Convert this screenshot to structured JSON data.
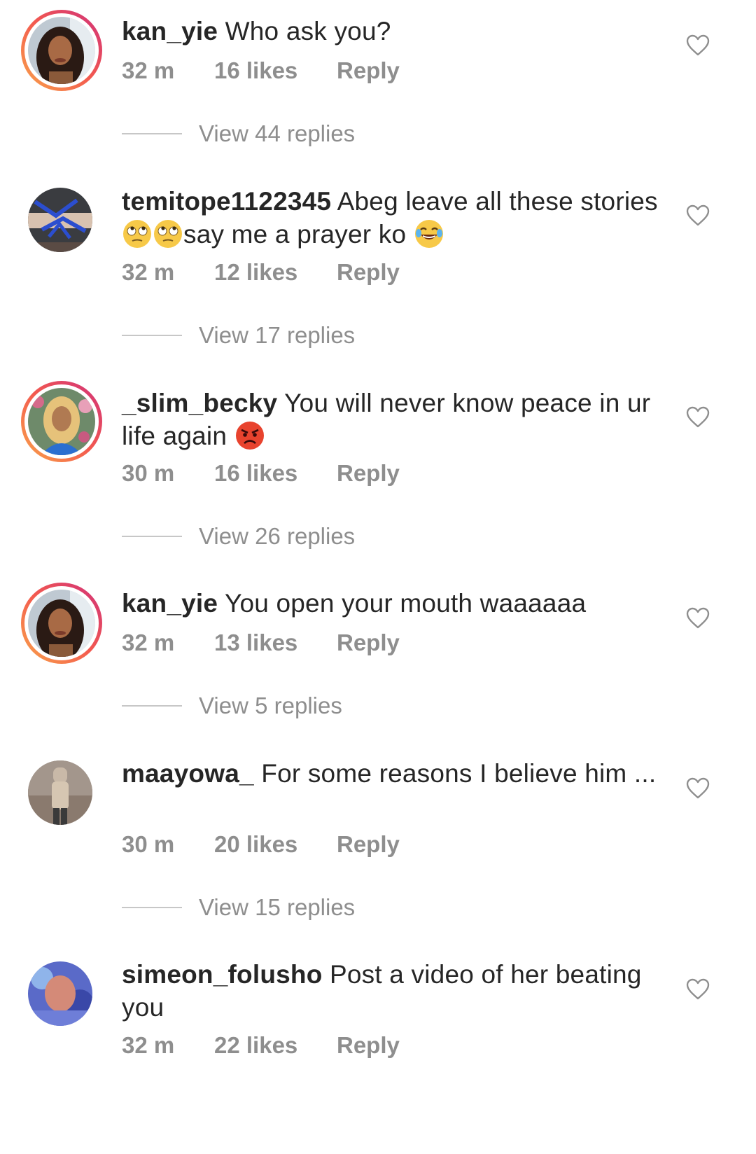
{
  "comments": [
    {
      "username": "kan_yie",
      "text": "Who ask you?",
      "time": "32 m",
      "likes": "16 likes",
      "reply_label": "Reply",
      "view_replies": "View 44 replies",
      "has_story": true
    },
    {
      "username": "temitope1122345",
      "text_part1": "Abeg leave all these stories",
      "emoji1": "rolling-eyes-emoji",
      "emoji2": "rolling-eyes-emoji",
      "text_part2": "say me a prayer ko ",
      "emoji3": "tears-of-joy-emoji",
      "time": "32 m",
      "likes": "12 likes",
      "reply_label": "Reply",
      "view_replies": "View 17 replies",
      "has_story": false
    },
    {
      "username": "_slim_becky",
      "text": "You will never know peace in ur life again ",
      "emoji1": "angry-face-emoji",
      "time": "30 m",
      "likes": "16 likes",
      "reply_label": "Reply",
      "view_replies": "View 26 replies",
      "has_story": true
    },
    {
      "username": "kan_yie",
      "text": "You open your mouth waaaaaa",
      "time": "32 m",
      "likes": "13 likes",
      "reply_label": "Reply",
      "view_replies": "View 5 replies",
      "has_story": true
    },
    {
      "username": "maayowa_",
      "text": "For some reasons I believe him ...",
      "time": "30 m",
      "likes": "20 likes",
      "reply_label": "Reply",
      "view_replies": "View 15 replies",
      "has_story": false
    },
    {
      "username": "simeon_folusho",
      "text": "Post a video of her beating you",
      "time": "32 m",
      "likes": "22 likes",
      "reply_label": "Reply",
      "has_story": false
    }
  ],
  "icons": {
    "like": "heart-outline-icon"
  },
  "colors": {
    "text_primary": "#262626",
    "text_secondary": "#8e8e8e",
    "divider": "#c7c7c7",
    "story_ring_start": "#f9a54a",
    "story_ring_end": "#d0307a"
  }
}
